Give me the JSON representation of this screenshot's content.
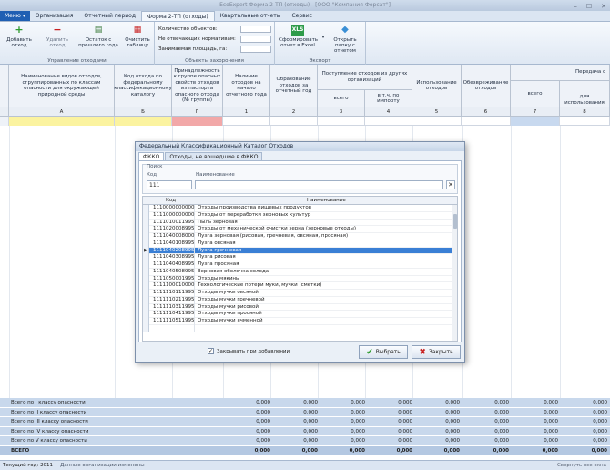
{
  "window": {
    "title": "EcoExpert Форма 2-ТП (отходы) - [ООО \"Компания Форсат\"]",
    "controls": [
      "–",
      "☐",
      "✕"
    ]
  },
  "menu": {
    "main_button": "Меню",
    "tabs": [
      "Организация",
      "Отчетный период",
      "Форма 2-ТП (отходы)",
      "Квартальные отчеты",
      "Сервис"
    ],
    "active_tab": "Форма 2-ТП (отходы)"
  },
  "ribbon": {
    "waste_group": {
      "label": "Управление отходами",
      "buttons": [
        {
          "label": "Добавить отход",
          "icon": "add-icon",
          "color": "#2e9b2e"
        },
        {
          "label": "Удалить отход",
          "icon": "remove-icon",
          "color": "#c82020"
        },
        {
          "label": "Остаток с прошлого года",
          "icon": "carryover-icon",
          "color": "#3a7a3a"
        },
        {
          "label": "Очистить таблицу",
          "icon": "clear-table-icon",
          "color": "#c82020"
        }
      ]
    },
    "objects_group": {
      "label": "Объекты захоронения",
      "fields": [
        "Количество объектов:",
        "Не отвечающих нормативам:",
        "Занимаемая площадь, га:"
      ]
    },
    "export_group": {
      "label": "Экспорт",
      "buttons": [
        {
          "label": "Сформировать отчет в Excel",
          "icon": "excel-icon"
        },
        {
          "label": "Открыть папку с отчетом",
          "icon": "folder-icon"
        }
      ]
    }
  },
  "grid": {
    "headers": [
      "Наименование видов отходов, сгруппированных по классам опасности для окружающей природной среды",
      "Код отхода по федеральному классификационному каталогу",
      "Принадлежность к группе опасных свойств отходов из паспорта опасного отхода (№ группы)",
      "Наличие отходов на начало отчетного года",
      "Образование отходов за отчетный год",
      "Поступление отходов из других организаций",
      "Использование отходов",
      "Обезвреживание отходов",
      "Передача с"
    ],
    "sub_headers": {
      "income_total": "всего",
      "income_import": "в т.ч. по импорту",
      "transfer_total": "всего",
      "transfer_use": "для использования"
    },
    "col_numbers": [
      "А",
      "Б",
      "Г",
      "1",
      "2",
      "3",
      "4",
      "5",
      "6",
      "7",
      "8"
    ],
    "totals": [
      {
        "label": "Всего по I классу опасности",
        "values": [
          "0,000",
          "0,000",
          "0,000",
          "0,000",
          "0,000",
          "0,000",
          "0,000",
          "0,000"
        ]
      },
      {
        "label": "Всего по II классу опасности",
        "values": [
          "0,000",
          "0,000",
          "0,000",
          "0,000",
          "0,000",
          "0,000",
          "0,000",
          "0,000"
        ]
      },
      {
        "label": "Всего по III классу опасности",
        "values": [
          "0,000",
          "0,000",
          "0,000",
          "0,000",
          "0,000",
          "0,000",
          "0,000",
          "0,000"
        ]
      },
      {
        "label": "Всего по IV классу опасности",
        "values": [
          "0,000",
          "0,000",
          "0,000",
          "0,000",
          "0,000",
          "0,000",
          "0,000",
          "0,000"
        ]
      },
      {
        "label": "Всего по V классу опасности",
        "values": [
          "0,000",
          "0,000",
          "0,000",
          "0,000",
          "0,000",
          "0,000",
          "0,000",
          "0,000"
        ]
      },
      {
        "label": "ВСЕГО",
        "values": [
          "0,000",
          "0,000",
          "0,000",
          "0,000",
          "0,000",
          "0,000",
          "0,000",
          "0,000"
        ]
      }
    ],
    "colors": {
      "row_yellow": "#fbf3a0",
      "cell_red": "#f2a8a8",
      "cell_blue": "#c8d9ef"
    }
  },
  "status": {
    "year_label": "Текущий год:",
    "year": "2011",
    "message": "Данные организации изменены",
    "right": "Свернуть все окна"
  },
  "dialog": {
    "title": "Федеральный Классификационный Каталог Отходов",
    "tabs": [
      "ФККО",
      "Отходы, не вошедшие в ФККО"
    ],
    "active_tab": "ФККО",
    "search": {
      "group_label": "Поиск",
      "code_label": "Код",
      "name_label": "Наименование",
      "code_value": "111",
      "name_value": ""
    },
    "columns": {
      "code": "Код",
      "name": "Наименование"
    },
    "rows": [
      {
        "code": "1110000000000",
        "name": "Отходы производства пищевых продуктов"
      },
      {
        "code": "1111000000000",
        "name": "Отходы от переработки зерновых культур"
      },
      {
        "code": "1111010011995",
        "name": "Пыль зерновая"
      },
      {
        "code": "1111020008995",
        "name": "Отходы от механической очистки зерна (зерновые отходы)"
      },
      {
        "code": "1111040008000",
        "name": "Лузга зерновая (рисовая, гречневая, овсяная, просяная)"
      },
      {
        "code": "1111040108995",
        "name": "Лузга овсяная"
      },
      {
        "code": "1111040208995",
        "name": "Лузга гречневая",
        "selected": true
      },
      {
        "code": "1111040308995",
        "name": "Лузга рисовая"
      },
      {
        "code": "1111040408995",
        "name": "Лузга просяная"
      },
      {
        "code": "1111040508995",
        "name": "Зерновая оболочка солода"
      },
      {
        "code": "1111050001995",
        "name": "Отходы мякины"
      },
      {
        "code": "1111100010000",
        "name": "Технологические потери муки, мучки (сметки)"
      },
      {
        "code": "1111110111995",
        "name": "Отходы мучки овсяной"
      },
      {
        "code": "1111110211995",
        "name": "Отходы мучки гречневой"
      },
      {
        "code": "1111110311995",
        "name": "Отходы мучки рисовой"
      },
      {
        "code": "1111110411995",
        "name": "Отходы мучки просяной"
      },
      {
        "code": "1111110511995",
        "name": "Отходы мучки ячменной"
      },
      {
        "code": "",
        "name": ""
      }
    ],
    "checkbox_label": "Закрывать при добавлении",
    "checkbox_checked": true,
    "ok_label": "Выбрать",
    "close_label": "Закрыть"
  }
}
